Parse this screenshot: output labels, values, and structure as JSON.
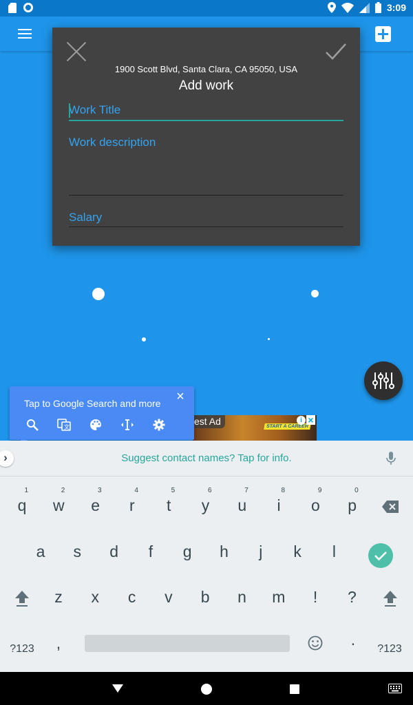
{
  "status_bar": {
    "time": "3:09"
  },
  "dialog": {
    "address": "1900 Scott Blvd, Santa Clara, CA 95050, USA",
    "title": "Add work",
    "work_title_placeholder": "Work Title",
    "work_description_placeholder": "Work description",
    "salary_placeholder": "Salary"
  },
  "ad": {
    "label": "est Ad",
    "cta": "START A CAREER"
  },
  "google_tip": {
    "text": "Tap to Google Search and more",
    "close": "×"
  },
  "suggestion_bar": {
    "text": "Suggest contact names? Tap for info."
  },
  "keyboard": {
    "row1": [
      {
        "ch": "q",
        "num": "1"
      },
      {
        "ch": "w",
        "num": "2"
      },
      {
        "ch": "e",
        "num": "3"
      },
      {
        "ch": "r",
        "num": "4"
      },
      {
        "ch": "t",
        "num": "5"
      },
      {
        "ch": "y",
        "num": "6"
      },
      {
        "ch": "u",
        "num": "7"
      },
      {
        "ch": "i",
        "num": "8"
      },
      {
        "ch": "o",
        "num": "9"
      },
      {
        "ch": "p",
        "num": "0"
      }
    ],
    "row2": [
      "a",
      "s",
      "d",
      "f",
      "g",
      "h",
      "j",
      "k",
      "l"
    ],
    "row3": [
      "z",
      "x",
      "c",
      "v",
      "b",
      "n",
      "m",
      "!",
      "?"
    ],
    "symbols_left": "?123",
    "symbols_right": "?123",
    "comma": ",",
    "period": "·"
  },
  "colors": {
    "primary": "#1e95ea",
    "dialog_bg": "#424242",
    "accent": "#26a69a",
    "hint": "#33a3f1"
  }
}
